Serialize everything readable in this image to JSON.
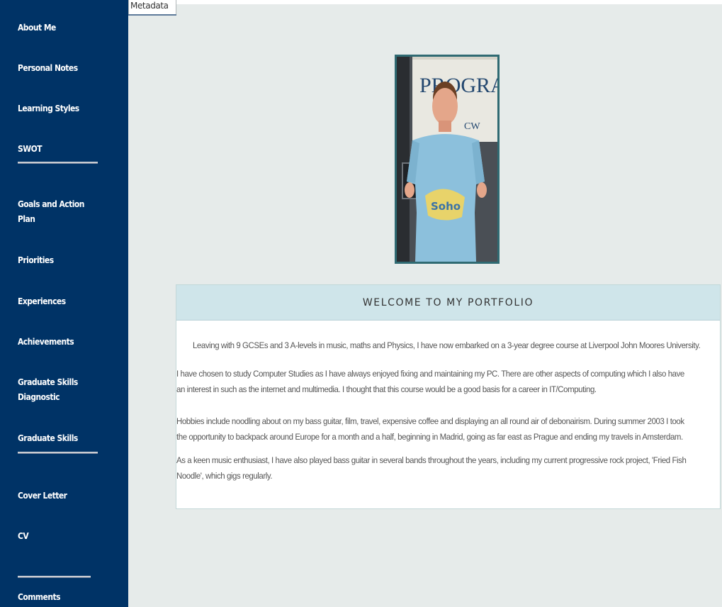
{
  "sidebar": {
    "items": [
      {
        "label": "About Me"
      },
      {
        "label": "Personal Notes"
      },
      {
        "label": "Learning Styles"
      },
      {
        "label": "SWOT"
      },
      {
        "label": "Goals and Action Plan"
      },
      {
        "label": "Priorities"
      },
      {
        "label": "Experiences"
      },
      {
        "label": "Achievements"
      },
      {
        "label": "Graduate Skills Diagnostic"
      },
      {
        "label": "Graduate Skills"
      },
      {
        "label": "Cover Letter"
      },
      {
        "label": "CV"
      },
      {
        "label": "Comments"
      }
    ]
  },
  "tabs": {
    "metadata_label": "Metadata"
  },
  "photo": {
    "sign_text": "PROGRAM",
    "sign_sub": "CW",
    "shirt_print": "Soho"
  },
  "welcome": {
    "title": "WELCOME TO MY PORTFOLIO",
    "paragraphs": [
      "Leaving with 9 GCSEs and 3 A-levels in music, maths and Physics, I have now embarked on a 3-year degree course at Liverpool John Moores University.",
      "I have chosen to study Computer Studies as I have always enjoyed fixing and maintaining my PC. There are other aspects of computing which I also have an interest in such as the internet and multimedia. I thought that this course would be a good basis for a career in IT/Computing.",
      "Hobbies include noodling about on my bass guitar, film, travel, expensive coffee and displaying an all round air of debonairism. During summer 2003 I took the opportunity to backpack around Europe for a month and a half, beginning in Madrid, going as far east as Prague and ending my travels in Amsterdam.",
      "As a keen music enthusiast, I have also played bass guitar in several bands throughout the years, including my current progressive rock project, 'Fried Fish Noodle', which gigs regularly."
    ]
  },
  "colors": {
    "sidebar_bg": "#003366",
    "content_bg": "#e6ebea",
    "panel_header_bg": "#cfe5ea",
    "photo_frame": "#2f6a72"
  }
}
